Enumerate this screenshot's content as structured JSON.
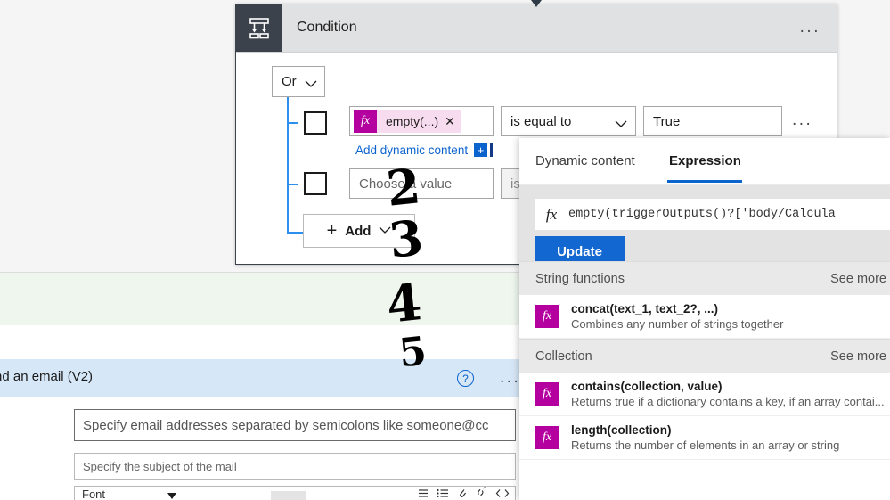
{
  "condition_card": {
    "icon": "condition-branch-icon",
    "title": "Condition",
    "overflow": "...",
    "group_operator": {
      "value": "Or",
      "chevron": "chevron-down-icon"
    },
    "rows": [
      {
        "checkbox_checked": false,
        "left_operand": {
          "fx_glyph": "fx",
          "token_label": "empty(...)",
          "remove": "✕"
        },
        "operator": "is equal to",
        "operator_chevron": "chevron-down-icon",
        "value": "True",
        "row_overflow": "...",
        "dynamic_link": "Add dynamic content",
        "dynamic_plus": "+"
      },
      {
        "checkbox_checked": false,
        "left_operand_placeholder": "Choose a value",
        "operator_placeholder": "is"
      }
    ],
    "add_button": {
      "plus": "+",
      "label": "Add",
      "chevron": "chevron-down-icon"
    }
  },
  "email_card": {
    "title": "nd an email (V2)",
    "help_icon": "?",
    "overflow": "...",
    "to_placeholder": "Specify email addresses separated by semicolons like someone@cc",
    "subject_placeholder": "Specify the subject of the mail",
    "toolbar": {
      "font_label": "Font",
      "icons": [
        "list-icon",
        "bulleted-list-icon",
        "attachment-icon",
        "unlink-icon",
        "code-icon"
      ]
    }
  },
  "panel": {
    "tabs": [
      {
        "label": "Dynamic content",
        "active": false
      },
      {
        "label": "Expression",
        "active": true
      }
    ],
    "expression": {
      "fx_glyph": "fx",
      "value": "empty(triggerOutputs()?['body/Calcula",
      "update_label": "Update"
    },
    "groups": [
      {
        "title": "String functions",
        "see_more": "See more",
        "functions": [
          {
            "fx_glyph": "fx",
            "name": "concat(text_1, text_2?, ...)",
            "description": "Combines any number of strings together"
          }
        ]
      },
      {
        "title": "Collection",
        "see_more": "See more",
        "functions": [
          {
            "fx_glyph": "fx",
            "name": "contains(collection, value)",
            "description": "Returns true if a dictionary contains a key, if an array contai..."
          },
          {
            "fx_glyph": "fx",
            "name": "length(collection)",
            "description": "Returns the number of elements in an array or string"
          }
        ]
      }
    ]
  },
  "annotations": [
    {
      "id": "step-2",
      "text": "2"
    },
    {
      "id": "step-3",
      "text": "3"
    },
    {
      "id": "step-4",
      "text": "4"
    },
    {
      "id": "step-5",
      "text": "5"
    }
  ],
  "colors": {
    "accent_blue": "#0b63ce",
    "update_blue": "#1367d0",
    "fx_magenta": "#b4009e",
    "token_pink": "#f7dbef",
    "header_gray": "#dfe1e3",
    "icon_dark": "#3b424b",
    "band_green": "#eef6ee",
    "band_blue": "#d6e7f7",
    "tree_blue": "#2a8fee"
  }
}
